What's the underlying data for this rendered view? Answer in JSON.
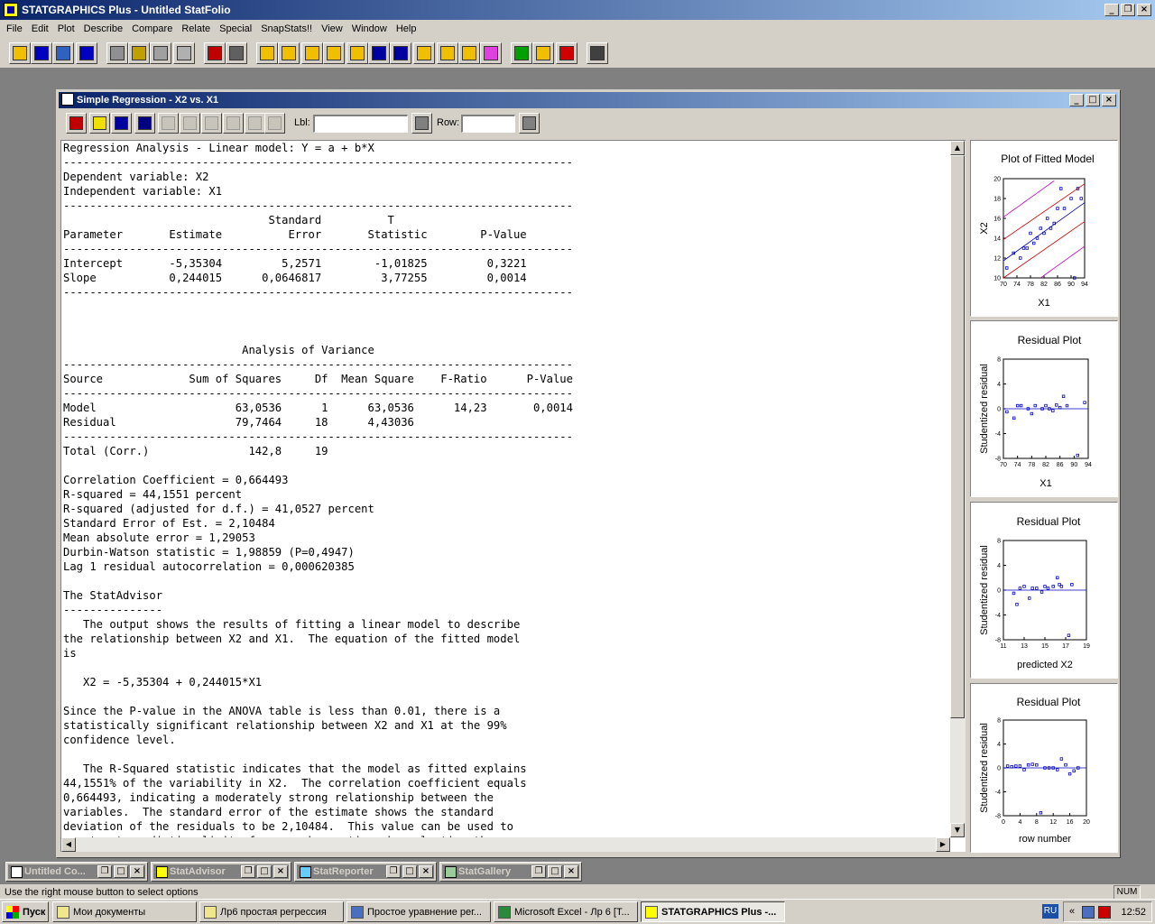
{
  "app": {
    "title": "STATGRAPHICS Plus - Untitled StatFolio",
    "menu": [
      "File",
      "Edit",
      "Plot",
      "Describe",
      "Compare",
      "Relate",
      "Special",
      "SnapStats!!",
      "View",
      "Window",
      "Help"
    ]
  },
  "toolbar_icons": [
    "open-folder-icon",
    "save-icon",
    "datasheet-icon",
    "save-data-icon",
    "cut-icon",
    "copy-icon",
    "paste-icon",
    "undo-icon",
    "print-icon",
    "print-preview-icon",
    "scatterplot-icon",
    "summary-icon",
    "histogram-icon",
    "xy-icon",
    "scatter-icon",
    "lineplot-icon",
    "distribution-icon",
    "trend-icon",
    "sphere-icon",
    "boxplot-icon",
    "gallery-icon",
    "next-icon",
    "advisor-icon",
    "help-icon",
    "calculator-icon"
  ],
  "toolbar_colors": [
    "#f0c000",
    "#0000c0",
    "#3060c0",
    "#0000c0",
    "#909090",
    "#c0a000",
    "#a0a0a0",
    "#b0b0b0",
    "#c00000",
    "#606060",
    "#f0c000",
    "#f0c000",
    "#f0c000",
    "#f0c000",
    "#f0c000",
    "#0000a0",
    "#0000a0",
    "#f0c000",
    "#f0c000",
    "#f0c000",
    "#e040e0",
    "#00a000",
    "#f0c000",
    "#d00000",
    "#404040"
  ],
  "child": {
    "title": "Simple Regression - X2 vs. X1",
    "lbl_label": "Lbl:",
    "row_label": "Row:",
    "lbl_value": "",
    "row_value": ""
  },
  "output_lines": [
    "Regression Analysis - Linear model: Y = a + b*X",
    "-----------------------------------------------------------------------------",
    "Dependent variable: X2",
    "Independent variable: X1",
    "-----------------------------------------------------------------------------",
    "                               Standard          T",
    "Parameter       Estimate          Error       Statistic        P-Value",
    "-----------------------------------------------------------------------------",
    "Intercept       -5,35304         5,2571        -1,01825         0,3221",
    "Slope           0,244015      0,0646817         3,77255         0,0014",
    "-----------------------------------------------------------------------------",
    "",
    "",
    "",
    "                           Analysis of Variance",
    "-----------------------------------------------------------------------------",
    "Source             Sum of Squares     Df  Mean Square    F-Ratio      P-Value",
    "-----------------------------------------------------------------------------",
    "Model                     63,0536      1      63,0536      14,23       0,0014",
    "Residual                  79,7464     18      4,43036",
    "-----------------------------------------------------------------------------",
    "Total (Corr.)               142,8     19",
    "",
    "Correlation Coefficient = 0,664493",
    "R-squared = 44,1551 percent",
    "R-squared (adjusted for d.f.) = 41,0527 percent",
    "Standard Error of Est. = 2,10484",
    "Mean absolute error = 1,29053",
    "Durbin-Watson statistic = 1,98859 (P=0,4947)",
    "Lag 1 residual autocorrelation = 0,000620385",
    "",
    "The StatAdvisor",
    "---------------",
    "   The output shows the results of fitting a linear model to describe",
    "the relationship between X2 and X1.  The equation of the fitted model",
    "is",
    "",
    "   X2 = -5,35304 + 0,244015*X1",
    "",
    "Since the P-value in the ANOVA table is less than 0.01, there is a",
    "statistically significant relationship between X2 and X1 at the 99%",
    "confidence level.",
    "",
    "   The R-Squared statistic indicates that the model as fitted explains",
    "44,1551% of the variability in X2.  The correlation coefficient equals",
    "0,664493, indicating a moderately strong relationship between the",
    "variables.  The standard error of the estimate shows the standard",
    "deviation of the residuals to be 2,10484.  This value can be used to",
    "construct prediction limits for new observations by selecting the"
  ],
  "chart_data": [
    {
      "type": "scatter",
      "title": "Plot of Fitted Model",
      "xlabel": "X1",
      "ylabel": "X2",
      "xlim": [
        70,
        94
      ],
      "ylim": [
        10,
        20
      ],
      "xticks": [
        "70",
        "74",
        "78",
        "82",
        "86",
        "90",
        "94"
      ],
      "yticks": [
        "10",
        "12",
        "14",
        "16",
        "18",
        "20"
      ],
      "points": [
        [
          71,
          11
        ],
        [
          73,
          12.5
        ],
        [
          75,
          12
        ],
        [
          76,
          13
        ],
        [
          77,
          13
        ],
        [
          78,
          14.5
        ],
        [
          79,
          13.5
        ],
        [
          80,
          14
        ],
        [
          81,
          15
        ],
        [
          82,
          14.5
        ],
        [
          83,
          16
        ],
        [
          84,
          15
        ],
        [
          85,
          15.5
        ],
        [
          86,
          17
        ],
        [
          87,
          19
        ],
        [
          88,
          17
        ],
        [
          90,
          18
        ],
        [
          91,
          10
        ],
        [
          92,
          19
        ],
        [
          93,
          18
        ]
      ],
      "fit": {
        "intercept": -5.35304,
        "slope": 0.244015
      },
      "colors": {
        "points": "#0000c0",
        "fit": "#0000c0",
        "confidence": "#d00000",
        "prediction": "#c000c0"
      }
    },
    {
      "type": "scatter",
      "title": "Residual Plot",
      "xlabel": "X1",
      "ylabel": "Studentized residual",
      "xlim": [
        70,
        94
      ],
      "ylim": [
        -8,
        8
      ],
      "xticks": [
        "70",
        "74",
        "78",
        "82",
        "86",
        "90",
        "94"
      ],
      "yticks": [
        "8",
        "4",
        "0",
        "-4",
        "-8"
      ],
      "points": [
        [
          71,
          -0.5
        ],
        [
          73,
          -1.5
        ],
        [
          74,
          0.5
        ],
        [
          75,
          0.5
        ],
        [
          77,
          0
        ],
        [
          78,
          -0.8
        ],
        [
          79,
          0.5
        ],
        [
          81,
          0
        ],
        [
          82,
          0.5
        ],
        [
          83,
          0
        ],
        [
          84,
          -0.3
        ],
        [
          85,
          0.6
        ],
        [
          86,
          0.2
        ],
        [
          87,
          2
        ],
        [
          88,
          0.5
        ],
        [
          91,
          -7.5
        ],
        [
          93,
          1
        ]
      ],
      "colors": {
        "points": "#0000c0",
        "zero_line": "#0000c0"
      }
    },
    {
      "type": "scatter",
      "title": "Residual Plot",
      "xlabel": "predicted X2",
      "ylabel": "Studentized residual",
      "xlim": [
        11,
        19
      ],
      "ylim": [
        -8,
        8
      ],
      "xticks": [
        "11",
        "13",
        "15",
        "17",
        "19"
      ],
      "yticks": [
        "8",
        "4",
        "0",
        "-4",
        "-8"
      ],
      "points": [
        [
          12,
          -0.5
        ],
        [
          12.3,
          -2.3
        ],
        [
          12.6,
          0.3
        ],
        [
          13,
          0.6
        ],
        [
          13.5,
          -1.3
        ],
        [
          13.8,
          0.3
        ],
        [
          14.2,
          0.3
        ],
        [
          14.7,
          -0.3
        ],
        [
          15,
          0.6
        ],
        [
          15.3,
          0.3
        ],
        [
          15.8,
          0.6
        ],
        [
          16.2,
          2
        ],
        [
          16.4,
          0.9
        ],
        [
          16.6,
          0.6
        ],
        [
          17.3,
          -7.3
        ],
        [
          17.6,
          0.9
        ]
      ],
      "colors": {
        "points": "#0000c0",
        "zero_line": "#0000c0"
      }
    },
    {
      "type": "scatter",
      "title": "Residual Plot",
      "xlabel": "row number",
      "ylabel": "Studentized residual",
      "xlim": [
        0,
        20
      ],
      "ylim": [
        -8,
        8
      ],
      "xticks": [
        "0",
        "4",
        "8",
        "12",
        "16",
        "20"
      ],
      "yticks": [
        "8",
        "4",
        "0",
        "-4",
        "-8"
      ],
      "points": [
        [
          1,
          0.3
        ],
        [
          2,
          0.2
        ],
        [
          3,
          0.3
        ],
        [
          4,
          0.3
        ],
        [
          5,
          -0.3
        ],
        [
          6,
          0.5
        ],
        [
          7,
          0.6
        ],
        [
          8,
          0.5
        ],
        [
          9,
          -7.5
        ],
        [
          10,
          0
        ],
        [
          11,
          0
        ],
        [
          12,
          0
        ],
        [
          13,
          -0.3
        ],
        [
          14,
          1.5
        ],
        [
          15,
          0.5
        ],
        [
          16,
          -1
        ],
        [
          17,
          -0.5
        ],
        [
          18,
          0
        ]
      ],
      "colors": {
        "points": "#0000c0",
        "zero_line": "#0000c0"
      }
    }
  ],
  "minimized_windows": [
    {
      "label": "Untitled Co..."
    },
    {
      "label": "StatAdvisor"
    },
    {
      "label": "StatReporter"
    },
    {
      "label": "StatGallery"
    }
  ],
  "status": {
    "text": "Use the right mouse button to select options",
    "num": "NUM"
  },
  "taskbar": {
    "start": "Пуск",
    "items": [
      {
        "label": "Мои документы"
      },
      {
        "label": "Лр6 простая регрессия"
      },
      {
        "label": "Простое уравнение рег..."
      },
      {
        "label": "Microsoft Excel - Лр 6  [Т..."
      },
      {
        "label": "STATGRAPHICS Plus -..."
      }
    ],
    "lang": "RU",
    "clock": "12:52"
  }
}
